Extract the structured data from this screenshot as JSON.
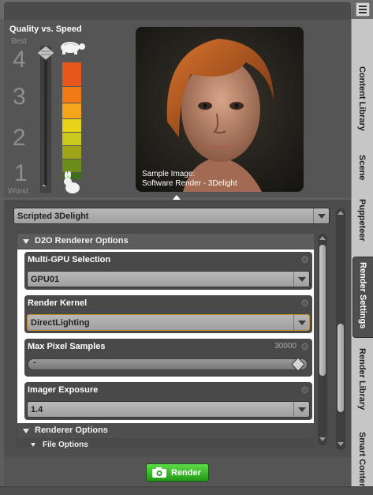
{
  "quality": {
    "title": "Quality vs. Speed",
    "best_label": "Best",
    "worst_label": "Worst",
    "levels": [
      "4",
      "3",
      "2",
      "1"
    ],
    "meter_colors": [
      "#e7561b",
      "#f07a16",
      "#f4a51b",
      "#e8d21a",
      "#c9c81d",
      "#9fa519",
      "#6b8c1a",
      "#3f6f1c"
    ]
  },
  "sample": {
    "caption_line1": "Sample Image:",
    "caption_line2": "Software Render - 3Delight"
  },
  "engine": {
    "selected": "Scripted 3Delight"
  },
  "d2o": {
    "header": "D2O Renderer Options",
    "multi_gpu": {
      "title": "Multi-GPU Selection",
      "value": "GPU01"
    },
    "render_kernel": {
      "title": "Render Kernel",
      "value": "DirectLighting"
    },
    "max_pixel_samples": {
      "title": "Max Pixel Samples",
      "value": "30000",
      "minus": "-"
    },
    "imager_exposure": {
      "title": "Imager Exposure",
      "value": "1.4"
    }
  },
  "renderer_options": {
    "header": "Renderer Options",
    "file_options": "File Options"
  },
  "render_button": {
    "label": "Render"
  },
  "side_tabs": [
    "Content Library",
    "Scene",
    "Puppeteer",
    "Render Settings",
    "Render Library",
    "Smart Content"
  ],
  "colors": {
    "accent_green": "#2fb01f",
    "highlight_orange": "#c58a2a"
  }
}
